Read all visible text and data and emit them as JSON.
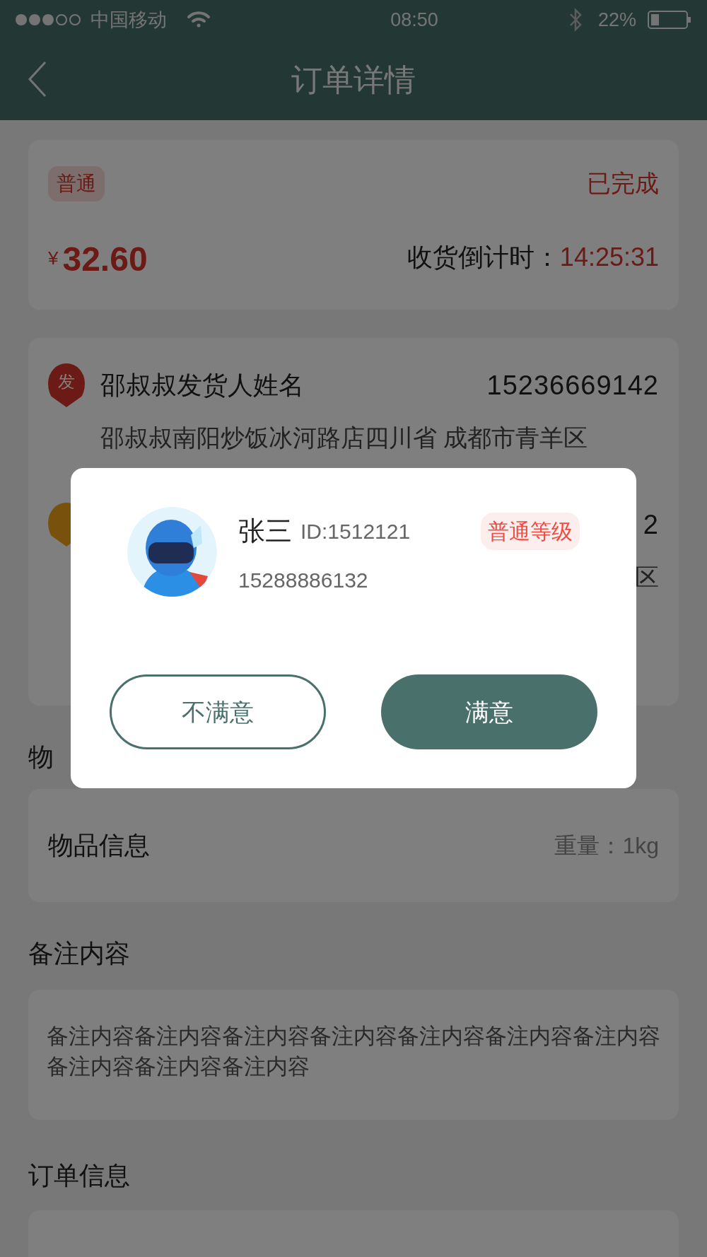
{
  "status_bar": {
    "carrier": "中国移动",
    "time": "08:50",
    "battery": "22%"
  },
  "nav": {
    "title": "订单详情"
  },
  "order": {
    "tag": "普通",
    "status": "已完成",
    "currency": "¥",
    "price": "32.60",
    "countdown_label": "收货倒计时：",
    "countdown": "14:25:31"
  },
  "addresses": [
    {
      "kind": "sender",
      "icon": "发",
      "name": "邵叔叔发货人姓名",
      "phone": "15236669142",
      "address": "邵叔叔南阳炒饭冰河路店四川省 成都市青羊区"
    },
    {
      "kind": "receiver",
      "phone": "2",
      "address": "区"
    }
  ],
  "goods": {
    "heading": "物",
    "name": "物品信息",
    "weight": "重量：1kg"
  },
  "notes": {
    "heading": "备注内容",
    "text": "备注内容备注内容备注内容备注内容备注内容备注内容备注内容备注内容备注内容备注内容"
  },
  "order_info": {
    "heading": "订单信息"
  },
  "dialog": {
    "name": "张三",
    "id": "ID:1512121",
    "level": "普通等级",
    "phone": "15288886132",
    "buttons": [
      {
        "label": "不满意",
        "kind": "outline"
      },
      {
        "label": "满意",
        "kind": "filled"
      }
    ]
  }
}
